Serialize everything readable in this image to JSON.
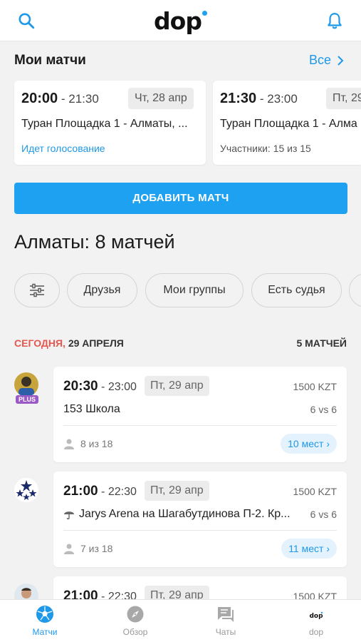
{
  "header": {
    "logo_text": "dop",
    "search_icon": "search-icon",
    "bell_icon": "bell-icon"
  },
  "my_matches": {
    "title": "Мои матчи",
    "all_link": "Все",
    "cards": [
      {
        "time_start": "20:00",
        "time_end": "21:30",
        "date": "Чт, 28 апр",
        "place": "Туран Площадка 1 - Алматы, ...",
        "status": "Идет голосование",
        "status_color": "#1e98e8"
      },
      {
        "time_start": "21:30",
        "time_end": "23:00",
        "date": "Пт, 29",
        "place": "Туран Площадка 1 - Алма",
        "status": "Участники: 15 из 15",
        "status_color": "#555555"
      }
    ]
  },
  "add_button": "ДОБАВИТЬ МАТЧ",
  "city_title": "Алматы: 8 матчей",
  "filters": [
    "Друзья",
    "Мои группы",
    "Есть судья"
  ],
  "day": {
    "today_label": "СЕГОДНЯ,",
    "date_label": "29 АПРЕЛЯ",
    "count": "5 МАТЧЕЙ"
  },
  "matches": [
    {
      "time_start": "20:30",
      "time_end": "23:00",
      "date": "Пт, 29 апр",
      "price": "1500 KZT",
      "place": "153 Школа",
      "format": "6 vs 6",
      "players": "8 из 18",
      "spots": "10 мест",
      "covered": false,
      "plus": "PLUS"
    },
    {
      "time_start": "21:00",
      "time_end": "22:30",
      "date": "Пт, 29 апр",
      "price": "1500 KZT",
      "place": "Jarys Arena на Шагабутдинова П-2. Кр...",
      "format": "6 vs 6",
      "players": "7 из 18",
      "spots": "11 мест",
      "covered": true
    },
    {
      "time_start": "21:00",
      "time_end": "22:30",
      "date": "Пт, 29 апр",
      "price": "1500 KZT"
    }
  ],
  "nav": [
    {
      "label": "Матчи",
      "icon": "soccer-ball-icon",
      "active": true
    },
    {
      "label": "Обзор",
      "icon": "compass-icon",
      "active": false
    },
    {
      "label": "Чаты",
      "icon": "chat-icon",
      "active": false
    },
    {
      "label": "dop",
      "icon": "dop-logo-icon",
      "active": false
    }
  ],
  "colors": {
    "accent": "#1ea1f1",
    "today": "#e5584f",
    "plus": "#9b59c6"
  }
}
